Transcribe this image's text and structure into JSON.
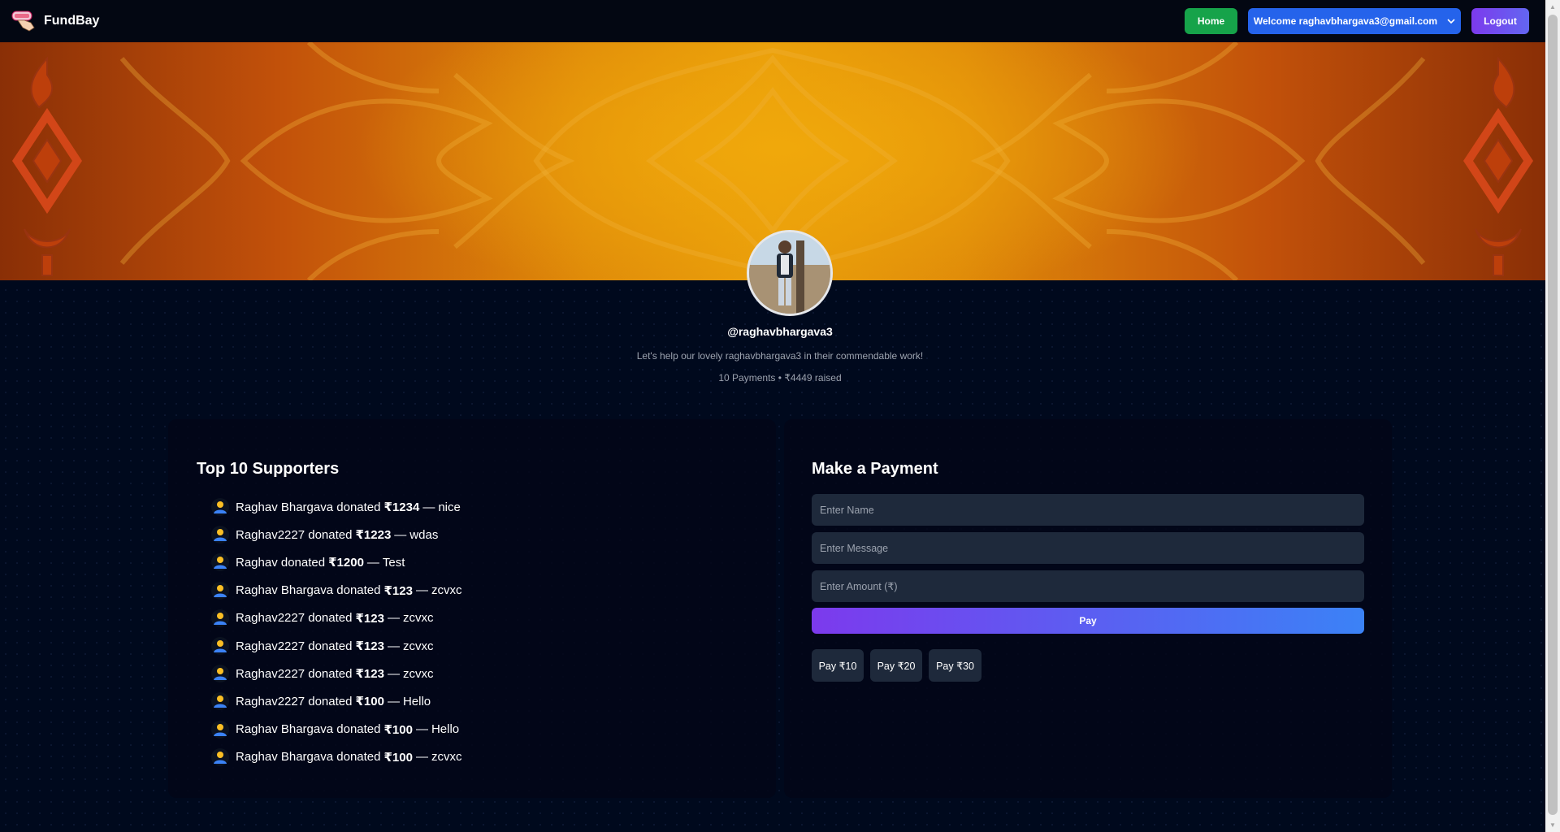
{
  "navbar": {
    "brand": "FundBay",
    "home_label": "Home",
    "welcome_label": "Welcome raghavbhargava3@gmail.com",
    "logout_label": "Logout"
  },
  "profile": {
    "username": "@raghavbhargava3",
    "tagline": "Let's help our lovely raghavbhargava3 in their commendable work!",
    "stats": "10 Payments • ₹4449 raised"
  },
  "supporters": {
    "title": "Top 10 Supporters",
    "items": [
      {
        "name": "Raghav Bhargava",
        "amount": "₹1234",
        "message": "nice"
      },
      {
        "name": "Raghav2227",
        "amount": "₹1223",
        "message": "wdas"
      },
      {
        "name": "Raghav",
        "amount": "₹1200",
        "message": "Test"
      },
      {
        "name": "Raghav Bhargava",
        "amount": "₹123",
        "message": "zcvxc"
      },
      {
        "name": "Raghav2227",
        "amount": "₹123",
        "message": "zcvxc"
      },
      {
        "name": "Raghav2227",
        "amount": "₹123",
        "message": "zcvxc"
      },
      {
        "name": "Raghav2227",
        "amount": "₹123",
        "message": "zcvxc"
      },
      {
        "name": "Raghav2227",
        "amount": "₹100",
        "message": "Hello"
      },
      {
        "name": "Raghav Bhargava",
        "amount": "₹100",
        "message": "Hello"
      },
      {
        "name": "Raghav Bhargava",
        "amount": "₹100",
        "message": "zcvxc"
      }
    ],
    "donated_word": "donated",
    "separator": "—"
  },
  "payment": {
    "title": "Make a Payment",
    "name_placeholder": "Enter Name",
    "message_placeholder": "Enter Message",
    "amount_placeholder": "Enter Amount (₹)",
    "pay_label": "Pay",
    "quick_amounts": [
      "Pay ₹10",
      "Pay ₹20",
      "Pay ₹30"
    ]
  },
  "colors": {
    "home": "#16a34a",
    "welcome": "#2563eb",
    "accent_purple": "#7c3aed",
    "background": "#00091d"
  }
}
